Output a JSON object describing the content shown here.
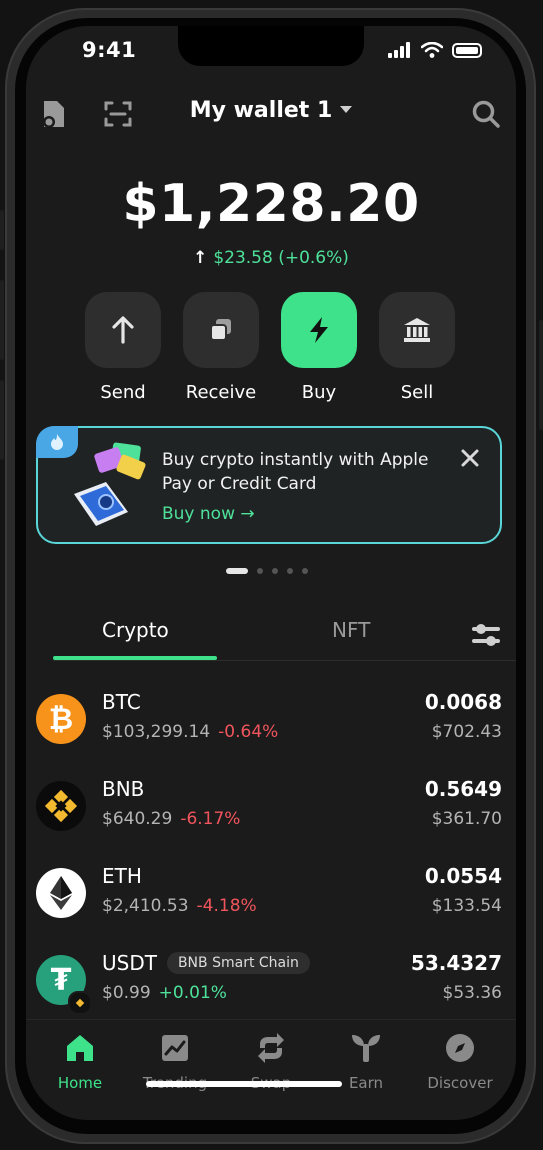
{
  "status_bar": {
    "time": "9:41"
  },
  "header": {
    "wallet_name": "My wallet 1"
  },
  "balance": {
    "total": "$1,228.20",
    "change": "$23.58 (+0.6%)"
  },
  "actions": [
    {
      "label": "Send",
      "icon": "arrow-up-icon"
    },
    {
      "label": "Receive",
      "icon": "copy-icon"
    },
    {
      "label": "Buy",
      "icon": "lightning-icon"
    },
    {
      "label": "Sell",
      "icon": "bank-icon"
    }
  ],
  "promo": {
    "text": "Buy crypto instantly with Apple Pay or Credit Card",
    "cta": "Buy now →"
  },
  "carousel": {
    "pages": 5,
    "active": 0
  },
  "tabs": [
    {
      "label": "Crypto",
      "active": true
    },
    {
      "label": "NFT",
      "active": false
    }
  ],
  "assets": [
    {
      "symbol": "BTC",
      "price": "$103,299.14",
      "change": "-0.64%",
      "direction": "down",
      "amount": "0.0068",
      "value": "$702.43",
      "color": "#f7931a"
    },
    {
      "symbol": "BNB",
      "price": "$640.29",
      "change": "-6.17%",
      "direction": "down",
      "amount": "0.5649",
      "value": "$361.70",
      "color": "#f3ba2f"
    },
    {
      "symbol": "ETH",
      "price": "$2,410.53",
      "change": "-4.18%",
      "direction": "down",
      "amount": "0.0554",
      "value": "$133.54",
      "color": "#ffffff"
    },
    {
      "symbol": "USDT",
      "chain": "BNB Smart Chain",
      "price": "$0.99",
      "change": "+0.01%",
      "direction": "up",
      "amount": "53.4327",
      "value": "$53.36",
      "color": "#26a17b"
    }
  ],
  "nav": [
    {
      "label": "Home",
      "active": true
    },
    {
      "label": "Trending",
      "active": false
    },
    {
      "label": "Swap",
      "active": false
    },
    {
      "label": "Earn",
      "active": false
    },
    {
      "label": "Discover",
      "active": false
    }
  ],
  "colors": {
    "accent": "#3ee28a",
    "negative": "#f0555d",
    "positive": "#4ee19a",
    "promo_border": "#5ad6d8"
  }
}
